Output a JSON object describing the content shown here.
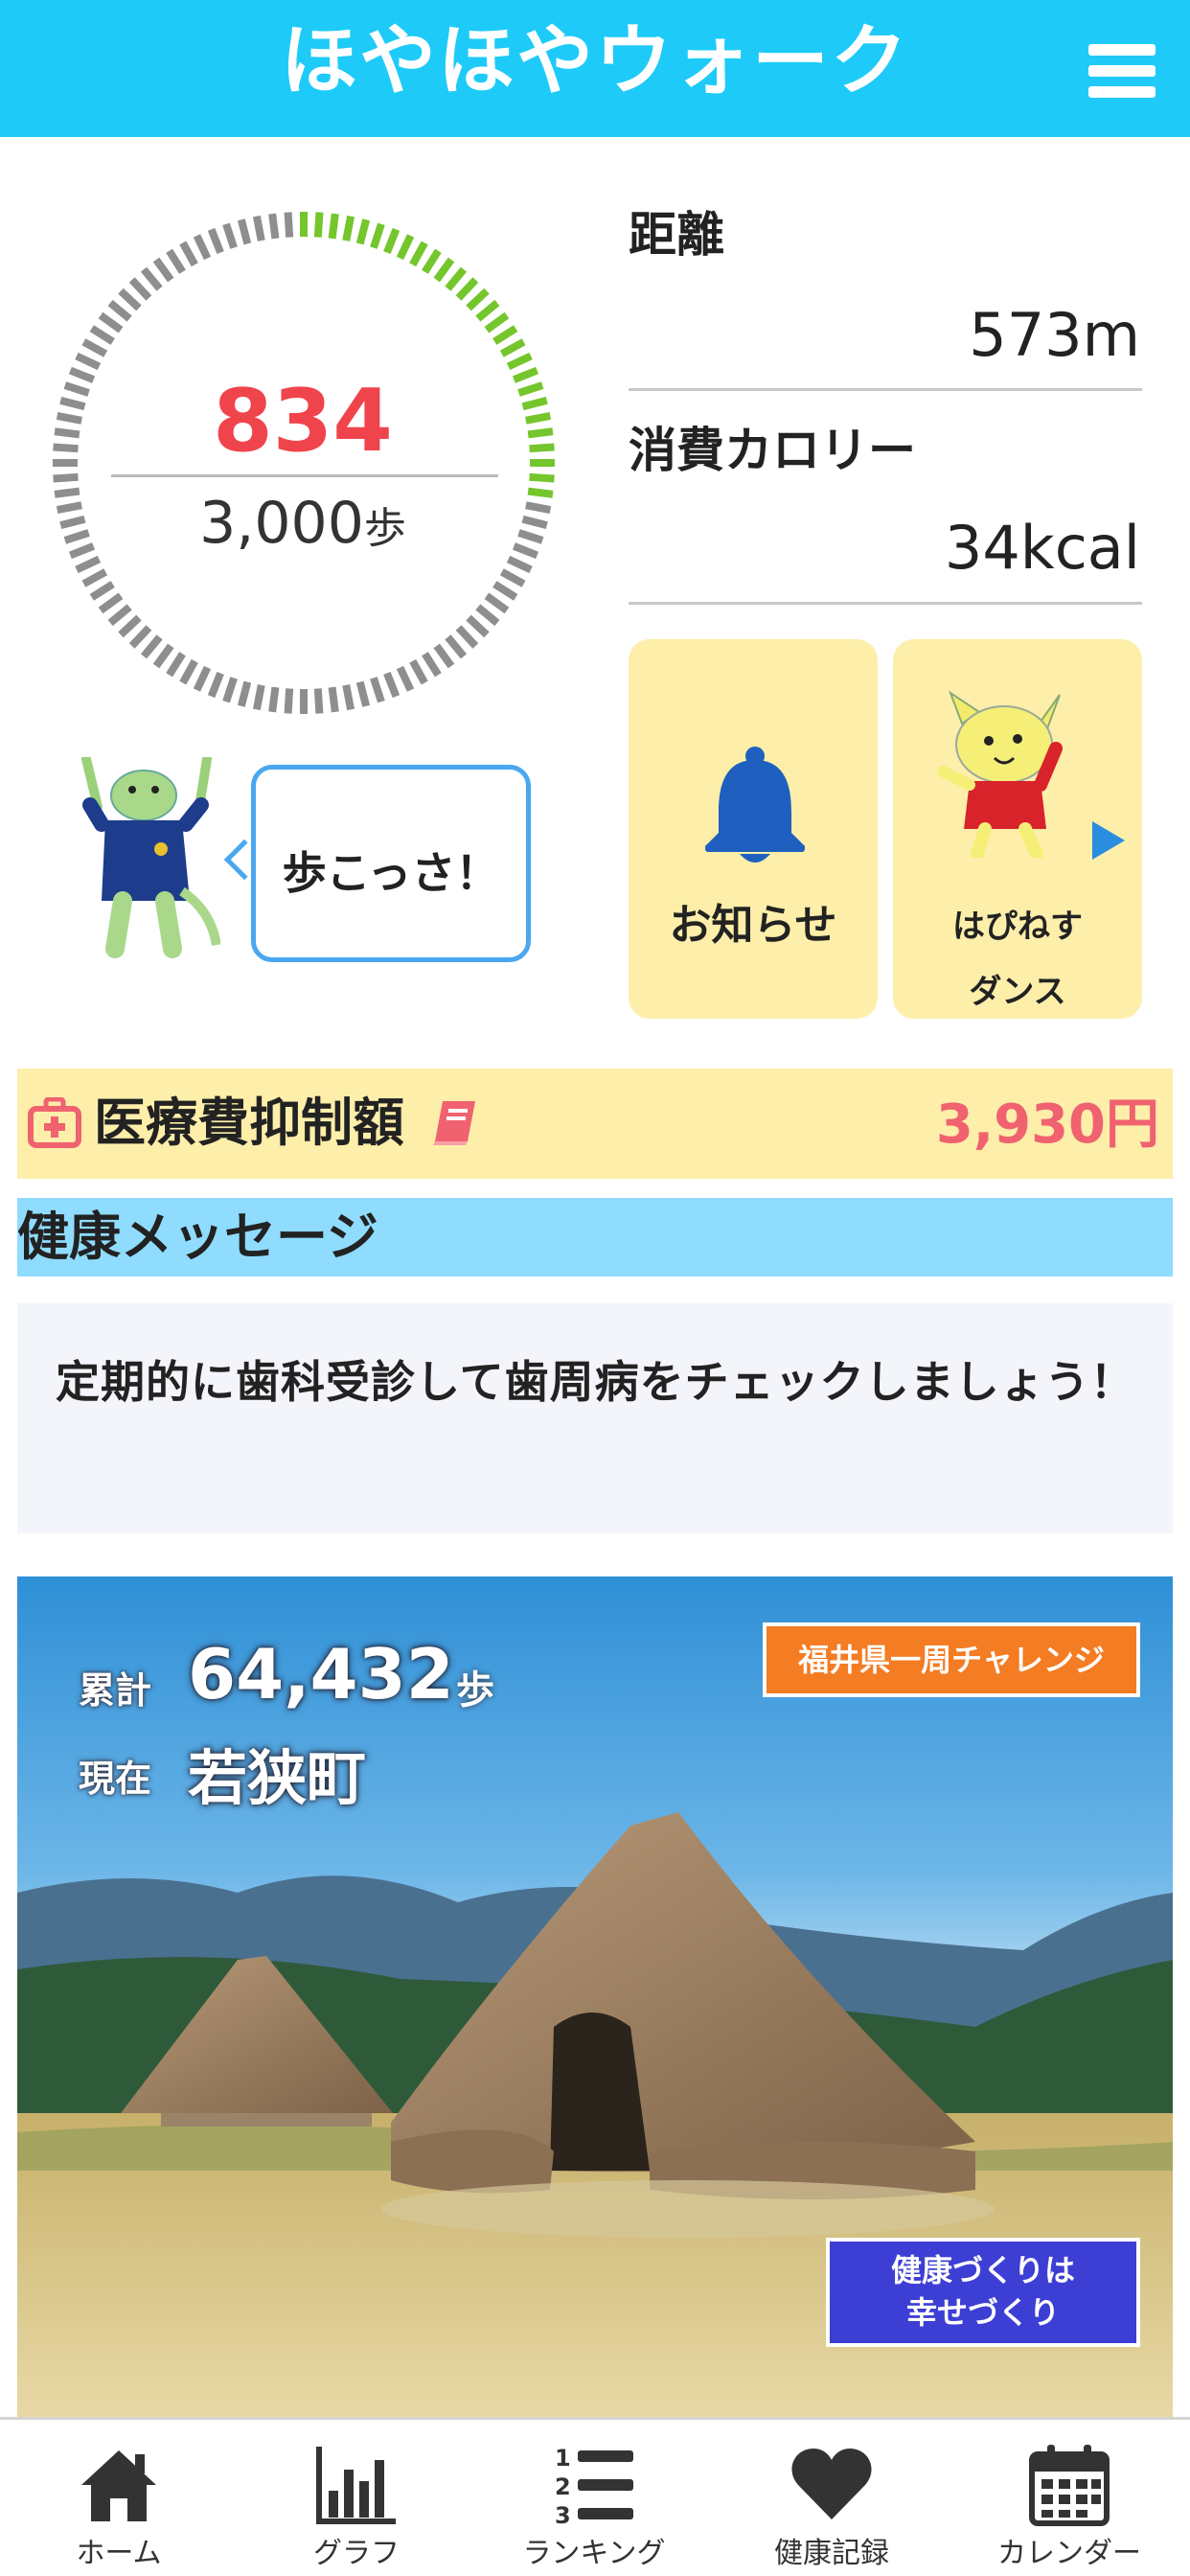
{
  "header": {
    "title": "ほやほやウォーク",
    "menu_icon": "hamburger-menu-icon"
  },
  "steps": {
    "current": "834",
    "goal": "3,000",
    "unit": "歩",
    "progress": 0.278,
    "progress_color": "#74c62c",
    "track_color": "#8e8e8e"
  },
  "stats": {
    "distance_label": "距離",
    "distance_value": "573m",
    "calorie_label": "消費カロリー",
    "calorie_value": "34kcal"
  },
  "tiles": {
    "notice_label": "お知らせ",
    "notice_icon": "bell-icon",
    "dance_label_1": "はぴねす",
    "dance_label_2": "ダンス",
    "dance_icon": "play-arrow-icon"
  },
  "mascot": {
    "speech": "歩こっさ！"
  },
  "medical": {
    "label": "医療費抑制額",
    "value": "3,930円",
    "icon": "first-aid-kit-icon",
    "info_icon": "book-icon",
    "accent": "#f06270"
  },
  "health_message": {
    "title": "健康メッセージ",
    "text": "定期的に歯科受診して歯周病をチェックしましょう！"
  },
  "challenge": {
    "total_label": "累計",
    "total_value": "64,432",
    "total_unit": "歩",
    "current_label": "現在",
    "current_value": "若狭町",
    "button_label": "福井県一周チャレンジ",
    "slogan_line1": "健康づくりは",
    "slogan_line2": "幸せづくり"
  },
  "nav": {
    "items": [
      {
        "label": "ホーム",
        "icon": "home-icon"
      },
      {
        "label": "グラフ",
        "icon": "bar-chart-icon"
      },
      {
        "label": "ランキング",
        "icon": "ranking-list-icon"
      },
      {
        "label": "健康記録",
        "icon": "heart-icon"
      },
      {
        "label": "カレンダー",
        "icon": "calendar-icon"
      }
    ]
  }
}
